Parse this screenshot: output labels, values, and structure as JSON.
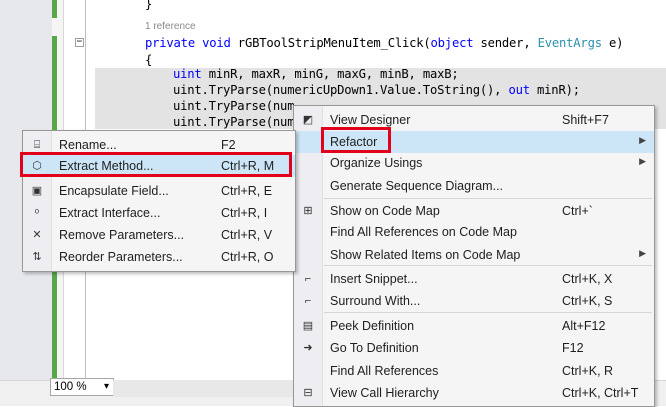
{
  "editor": {
    "references": "1 reference",
    "code": {
      "brace_close": "}",
      "method_kw1": "private",
      "method_kw2": "void",
      "method_name": " rGBToolStripMenuItem_Click(",
      "method_param1_kw": "object",
      "method_param1_name": " sender, ",
      "method_param2_type": "EventArgs",
      "method_param2_name": " e)",
      "brace_open": "{",
      "decl_kw": "uint",
      "decl_rest": " minR, maxR, minG, maxG, minB, maxB;",
      "line2_prefix": "uint.TryParse(numericUpDown1.Value.ToString(), ",
      "line2_out": "out",
      "line2_rest": " minR);",
      "line3_visible": "uint.TryParse(num",
      "line3_tail": "          )",
      "line4_visible": "uint.TryParse(num"
    }
  },
  "zoom": {
    "value": "100 %",
    "arrow": "▾"
  },
  "left_menu": {
    "items": [
      {
        "label": "Rename...",
        "shortcut": "F2",
        "icon": "rename-icon",
        "glyph": "⌸"
      },
      {
        "label": "Extract Method...",
        "shortcut": "Ctrl+R, M",
        "icon": "extract-method-icon",
        "glyph": "⬡"
      },
      {
        "label": "Encapsulate Field...",
        "shortcut": "Ctrl+R, E",
        "icon": "encapsulate-field-icon",
        "glyph": "▣"
      },
      {
        "label": "Extract Interface...",
        "shortcut": "Ctrl+R, I",
        "icon": "extract-interface-icon",
        "glyph": "ᵒ"
      },
      {
        "label": "Remove Parameters...",
        "shortcut": "Ctrl+R, V",
        "icon": "remove-parameters-icon",
        "glyph": "✕"
      },
      {
        "label": "Reorder Parameters...",
        "shortcut": "Ctrl+R, O",
        "icon": "reorder-parameters-icon",
        "glyph": "⇅"
      }
    ]
  },
  "right_menu": {
    "items": [
      {
        "label": "View Designer",
        "shortcut": "Shift+F7",
        "icon": "view-designer-icon",
        "glyph": "◩"
      },
      {
        "label": "Refactor",
        "shortcut": "",
        "icon": "",
        "glyph": "",
        "submenu": "▶"
      },
      {
        "label": "Organize Usings",
        "shortcut": "",
        "icon": "",
        "glyph": "",
        "submenu": "▶"
      },
      {
        "label": "Generate Sequence Diagram...",
        "shortcut": "",
        "icon": "",
        "glyph": ""
      },
      {
        "label": "Show on Code Map",
        "shortcut": "Ctrl+`",
        "icon": "code-map-icon",
        "glyph": "⊞"
      },
      {
        "label": "Find All References on Code Map",
        "shortcut": "",
        "icon": "",
        "glyph": ""
      },
      {
        "label": "Show Related Items on Code Map",
        "shortcut": "",
        "icon": "",
        "glyph": "",
        "submenu": "▶"
      },
      {
        "label": "Insert Snippet...",
        "shortcut": "Ctrl+K, X",
        "icon": "insert-snippet-icon",
        "glyph": "⌐"
      },
      {
        "label": "Surround With...",
        "shortcut": "Ctrl+K, S",
        "icon": "surround-with-icon",
        "glyph": "⌐"
      },
      {
        "label": "Peek Definition",
        "shortcut": "Alt+F12",
        "icon": "peek-definition-icon",
        "glyph": "▤"
      },
      {
        "label": "Go To Definition",
        "shortcut": "F12",
        "icon": "go-to-definition-icon",
        "glyph": "➜"
      },
      {
        "label": "Find All References",
        "shortcut": "Ctrl+K, R",
        "icon": "",
        "glyph": ""
      },
      {
        "label": "View Call Hierarchy",
        "shortcut": "Ctrl+K, Ctrl+T",
        "icon": "call-hierarchy-icon",
        "glyph": "⊟"
      }
    ]
  },
  "colors": {
    "highlight_box": "#e3001b",
    "menu_bg": "#f5f5f5",
    "selection": "#e3e3e3",
    "keyword": "#0000ff",
    "type": "#2b91af"
  }
}
